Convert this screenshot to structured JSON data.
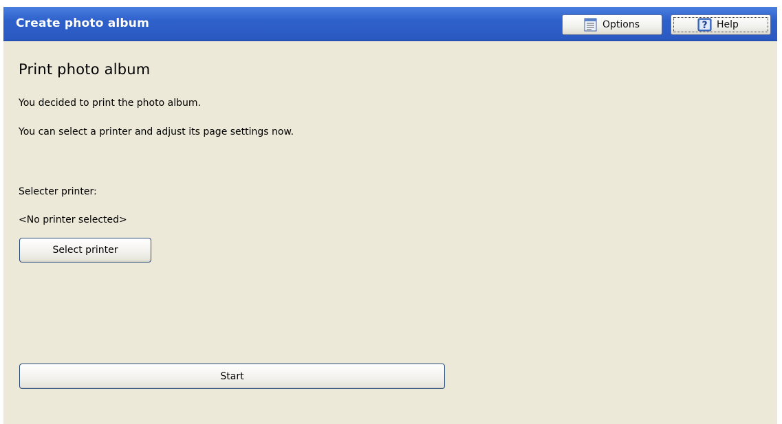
{
  "window": {
    "title": "Create photo album"
  },
  "toolbar": {
    "options_label": "Options",
    "options_icon": "list-icon",
    "help_label": "Help",
    "help_icon": "question-mark-icon"
  },
  "main": {
    "heading": "Print photo album",
    "line1": "You decided to print the photo album.",
    "line2": "You can select a printer and adjust its page settings now.",
    "printer_label": "Selecter printer:",
    "printer_value": "<No printer selected>",
    "select_printer_button": "Select printer",
    "start_button": "Start"
  },
  "colors": {
    "titlebar": "#2f61cb",
    "background": "#ece9d8",
    "title_text": "#ffffff"
  }
}
